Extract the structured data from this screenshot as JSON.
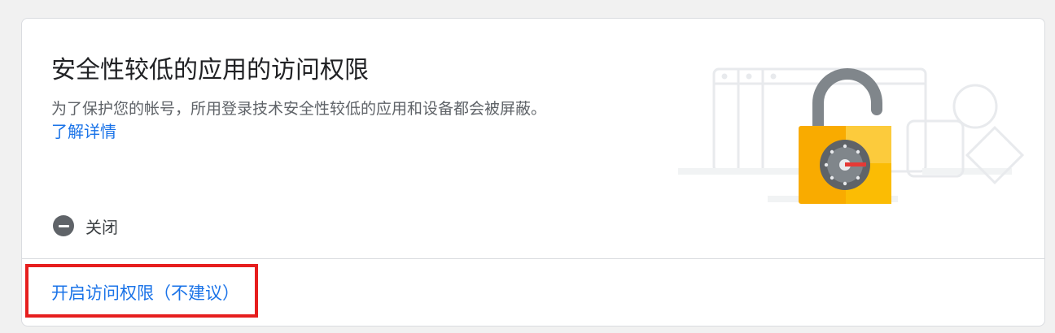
{
  "card": {
    "title": "安全性较低的应用的访问权限",
    "description": "为了保护您的帐号，所用登录技术安全性较低的应用和设备都会被屏蔽。",
    "learn_more": "了解详情",
    "status": {
      "icon": "minus-circle-icon",
      "label": "关闭"
    },
    "enable_link": "开启访问权限（不建议）"
  },
  "illustration": {
    "icon": "open-padlock-icon",
    "colors": {
      "lock_body": "#f9ab00",
      "lock_body_light": "#fdd663",
      "dial": "#5f6368",
      "needle": "#e53935",
      "outline": "#e8eaed"
    }
  },
  "colors": {
    "link": "#1a73e8",
    "highlight": "#e61e1e",
    "border": "#dadce0"
  }
}
